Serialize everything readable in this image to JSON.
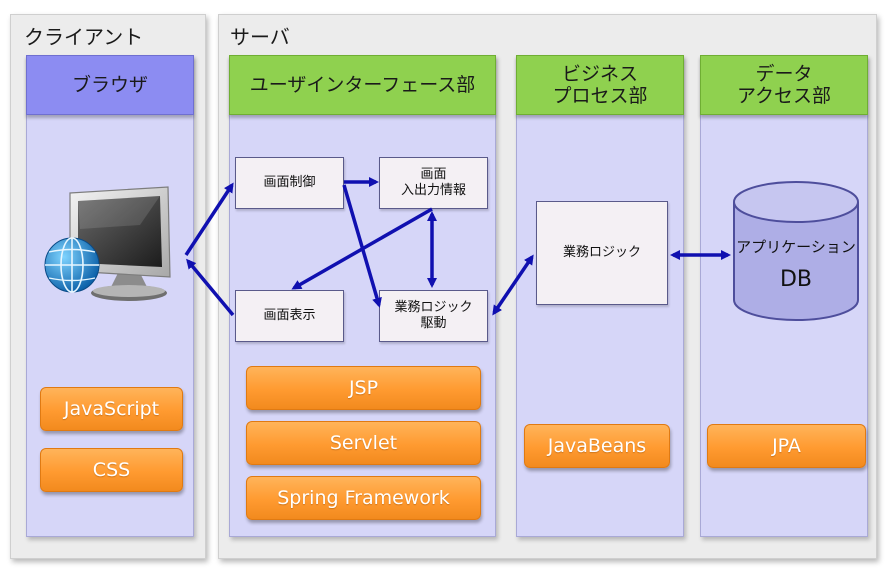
{
  "tiers": {
    "client": {
      "label": "クライアント"
    },
    "server": {
      "label": "サーバ"
    }
  },
  "columns": {
    "browser": {
      "header": "ブラウザ"
    },
    "ui": {
      "header": "ユーザインターフェース部"
    },
    "business": {
      "header_line1": "ビジネス",
      "header_line2": "プロセス部"
    },
    "data": {
      "header_line1": "データ",
      "header_line2": "アクセス部"
    }
  },
  "boxes": {
    "screen_control": "画面制御",
    "screen_io_line1": "画面",
    "screen_io_line2": "入出力情報",
    "screen_display": "画面表示",
    "logic_drive_line1": "業務ロジック",
    "logic_drive_line2": "駆動",
    "business_logic": "業務ロジック"
  },
  "database": {
    "label_line1": "アプリケーション",
    "label_line2": "DB"
  },
  "tech": {
    "javascript": "JavaScript",
    "css": "CSS",
    "jsp": "JSP",
    "servlet": "Servlet",
    "spring": "Spring Framework",
    "javabeans": "JavaBeans",
    "jpa": "JPA"
  },
  "icons": {
    "computer": "computer-monitor-globe-icon"
  },
  "colors": {
    "panel": "#ececec",
    "column": "#d6d6f8",
    "header_purple": "#8c8cf2",
    "header_green": "#8fd14f",
    "pill_orange": "#ff9a30",
    "arrow_blue": "#1010b0"
  }
}
